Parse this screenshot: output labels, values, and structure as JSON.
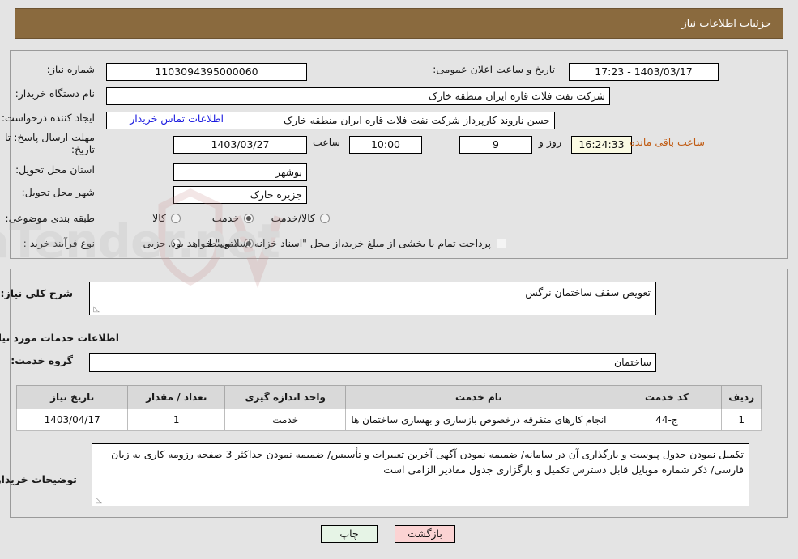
{
  "header": {
    "title": "جزئیات اطلاعات نیاز",
    "bg_color": "#8a6a3e"
  },
  "top_panel": {
    "need_number_label": "شماره نیاز:",
    "need_number_value": "1103094395000060",
    "announce_datetime_label": "تاریخ و ساعت اعلان عمومی:",
    "announce_datetime_value": "1403/03/17 - 17:23",
    "buyer_org_label": "نام دستگاه خریدار:",
    "buyer_org_value": "شرکت نفت فلات قاره ایران منطقه خارک",
    "requester_label": "ایجاد کننده درخواست:",
    "requester_value": "حسن ناروند کارپرداز شرکت نفت فلات قاره ایران منطقه خارک",
    "contact_link": "اطلاعات تماس خریدار",
    "deadline_label": "مهلت ارسال پاسخ: تا تاریخ:",
    "deadline_date": "1403/03/27",
    "hour_label": "ساعت",
    "deadline_time": "10:00",
    "days_value": "9",
    "days_label": "روز و",
    "countdown_value": "16:24:33",
    "countdown_label": "ساعت باقی مانده",
    "province_label": "استان محل تحویل:",
    "province_value": "بوشهر",
    "city_label": "شهر محل تحویل:",
    "city_value": "جزیره خارک",
    "category_label": "طبقه بندی موضوعی:",
    "category_options": [
      {
        "label": "کالا",
        "selected": false
      },
      {
        "label": "خدمت",
        "selected": true
      },
      {
        "label": "کالا/خدمت",
        "selected": false
      }
    ],
    "process_label": "نوع فرآیند خرید :",
    "process_options": [
      {
        "label": "جزیی",
        "selected": false
      },
      {
        "label": "متوسط",
        "selected": true
      }
    ],
    "treasury_checkbox_checked": false,
    "treasury_note": "پرداخت تمام یا بخشی از مبلغ خرید،از محل \"اسناد خزانه اسلامی\" خواهد بود."
  },
  "mid_panel": {
    "general_desc_label": "شرح کلی نیاز:",
    "general_desc_value": "تعویض سقف ساختمان نرگس",
    "services_info_heading": "اطلاعات خدمات مورد نیاز",
    "service_group_label": "گروه خدمت:",
    "service_group_value": "ساختمان",
    "table": {
      "columns": [
        "ردیف",
        "کد خدمت",
        "نام خدمت",
        "واحد اندازه گیری",
        "تعداد / مقدار",
        "تاریخ نیاز"
      ],
      "rows": [
        {
          "row_no": "1",
          "service_code": "ج-44",
          "service_name": "انجام کارهای متفرقه درخصوص بازسازی و بهسازی ساختمان ها",
          "unit": "خدمت",
          "quantity": "1",
          "need_date": "1403/04/17"
        }
      ]
    },
    "buyer_notes_label": "توضیحات خریدار:",
    "buyer_notes_value": "تکمیل نمودن جدول پیوست و بارگذاری آن در سامانه/ ضمیمه نمودن آگهی آخرین تغییرات و تأسیس/ ضمیمه نمودن حداکثر 3 صفحه رزومه کاری به زبان فارسی/ ذکر شماره موبایل قابل دسترس تکمیل و بارگزاری جدول مقادیر الزامی است"
  },
  "footer": {
    "print_button": "چاپ",
    "back_button": "بازگشت"
  },
  "watermark": {
    "text": "AriaTender.net"
  }
}
